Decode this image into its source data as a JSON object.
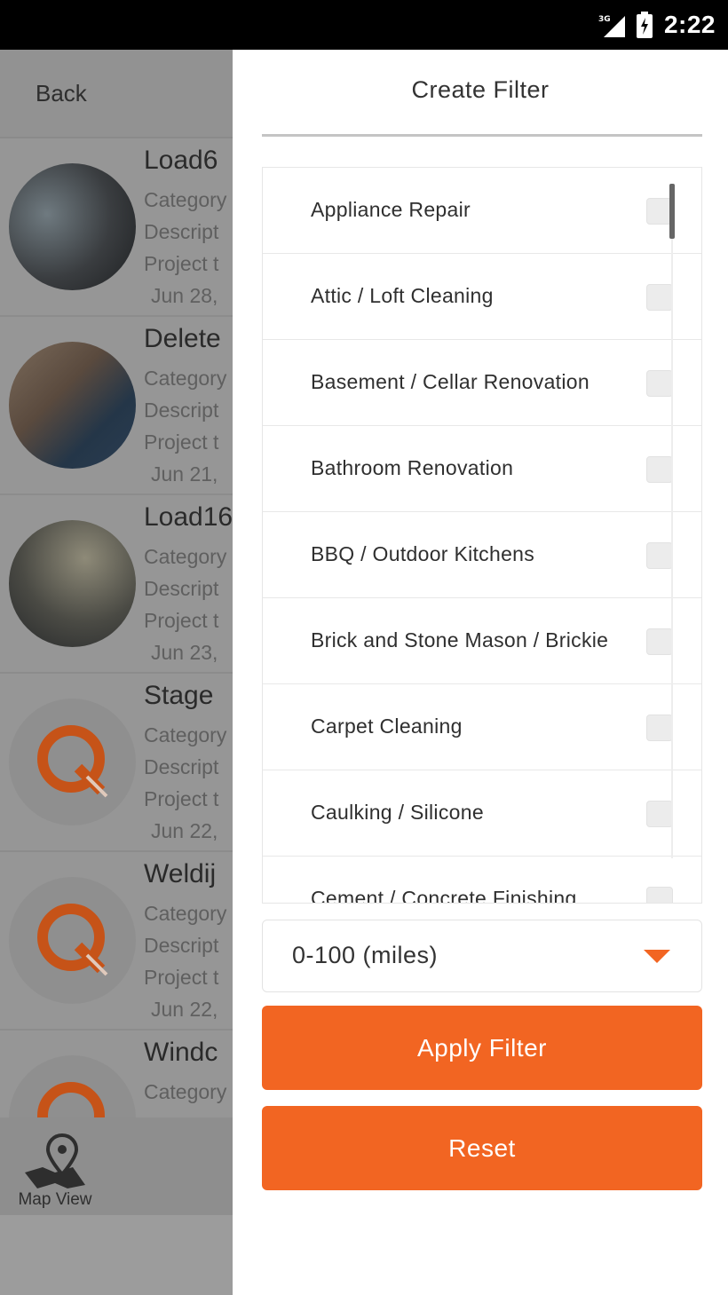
{
  "status_bar": {
    "network": "3G",
    "time": "2:22"
  },
  "background_screen": {
    "back_label": "Back",
    "items": [
      {
        "title": "Load6",
        "line1": "Category",
        "line2": "Descript",
        "line3": "Project t",
        "date": "Jun 28,"
      },
      {
        "title": "Delete",
        "line1": "Category",
        "line2": "Descript",
        "line3": "Project t",
        "date": "Jun 21,"
      },
      {
        "title": "Load16",
        "line1": "Category",
        "line2": "Descript",
        "line3": "Project t",
        "date": "Jun 23,"
      },
      {
        "title": "Stage",
        "line1": "Category",
        "line2": "Descript",
        "line3": "Project t",
        "date": "Jun 22,"
      },
      {
        "title": "Weldij",
        "line1": "Category",
        "line2": "Descript",
        "line3": "Project t",
        "date": "Jun 22,"
      },
      {
        "title": "Windc",
        "line1": "Category"
      }
    ],
    "map_view_label": "Map View"
  },
  "filter": {
    "title": "Create Filter",
    "categories": [
      {
        "label": "Appliance Repair",
        "checked": false
      },
      {
        "label": "Attic / Loft Cleaning",
        "checked": false
      },
      {
        "label": "Basement / Cellar Renovation",
        "checked": false
      },
      {
        "label": "Bathroom Renovation",
        "checked": false
      },
      {
        "label": "BBQ / Outdoor Kitchens",
        "checked": false
      },
      {
        "label": "Brick and Stone Mason / Brickie",
        "checked": false
      },
      {
        "label": "Carpet Cleaning",
        "checked": false
      },
      {
        "label": "Caulking / Silicone",
        "checked": false
      },
      {
        "label": "Cement / Concrete Finishing",
        "checked": false
      }
    ],
    "distance": {
      "selected": "0-100 (miles)"
    },
    "apply_label": "Apply Filter",
    "reset_label": "Reset"
  },
  "colors": {
    "accent": "#f26522",
    "status_bar": "#000000",
    "overlay": "#9b9b9b"
  }
}
